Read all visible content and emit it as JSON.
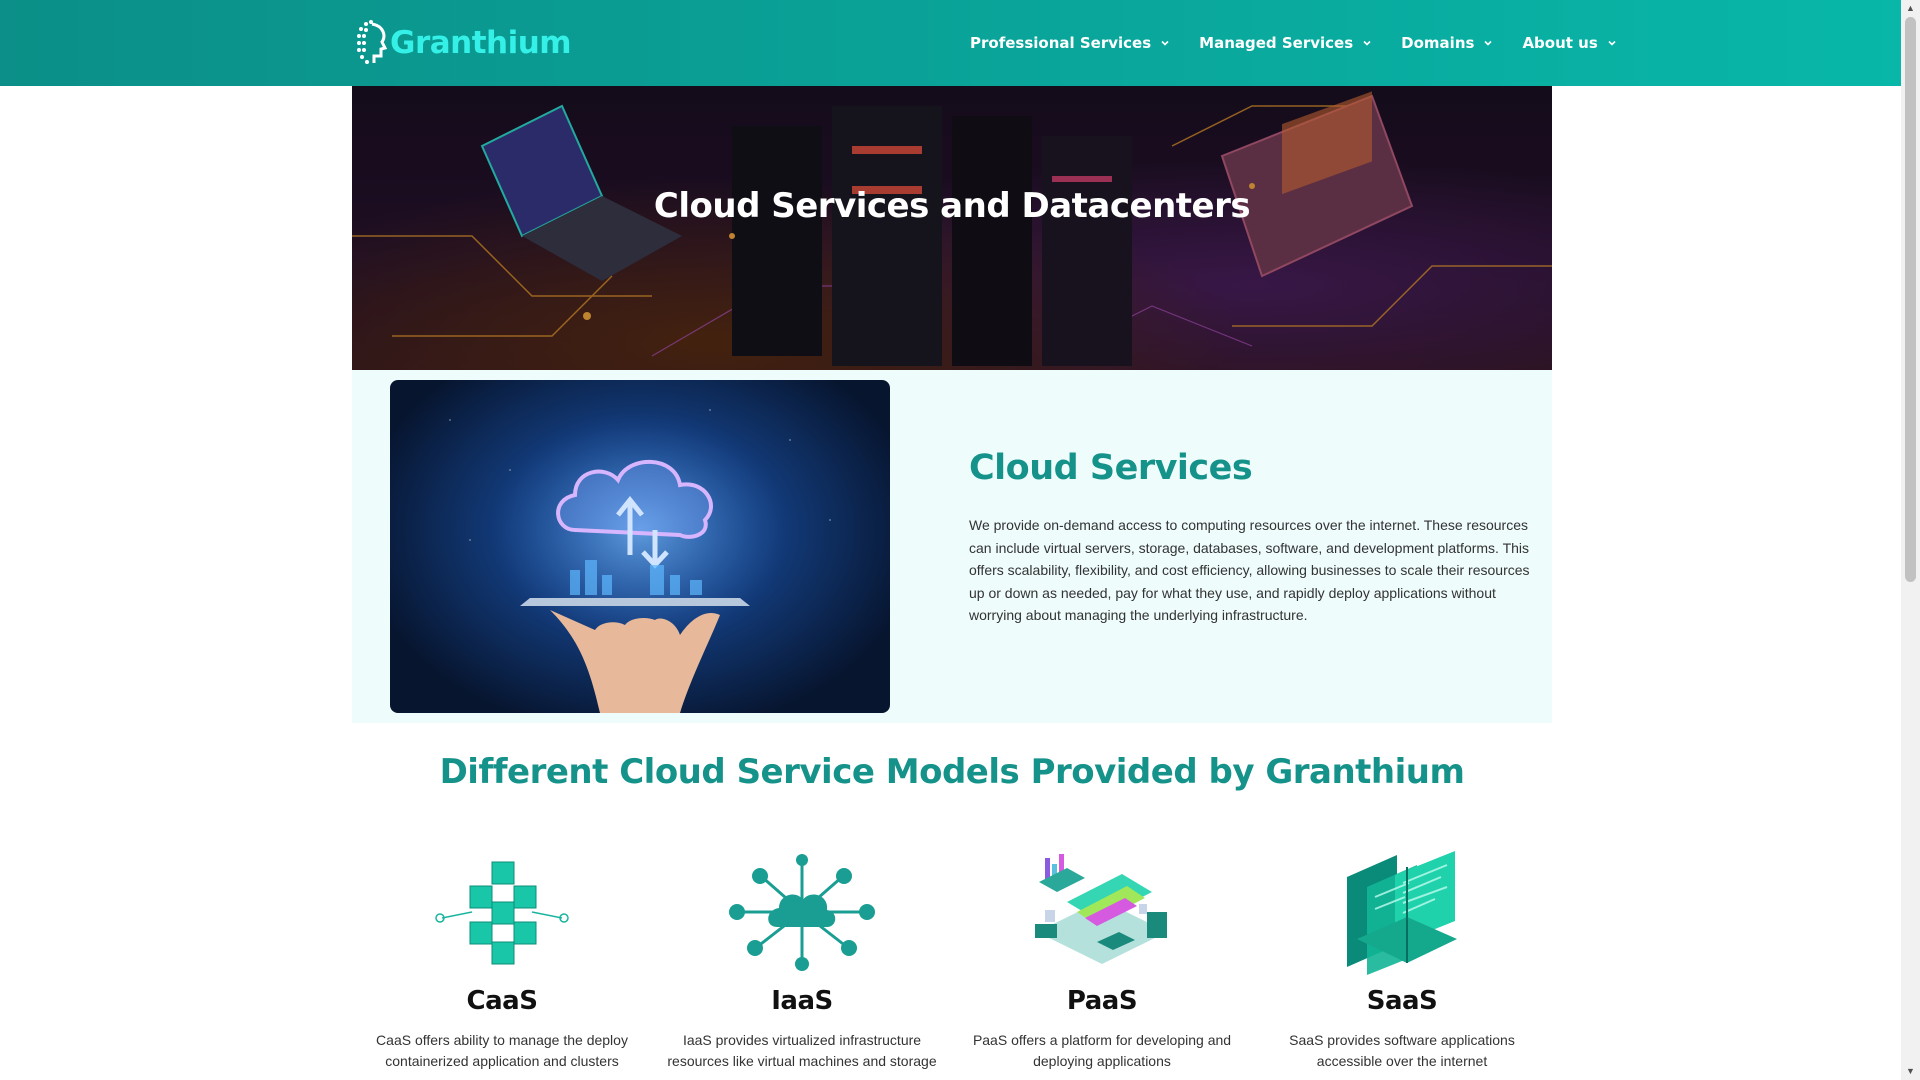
{
  "header": {
    "logo_text": "Granthium",
    "nav": [
      {
        "label": "Professional Services"
      },
      {
        "label": "Managed Services"
      },
      {
        "label": "Domains"
      },
      {
        "label": "About us"
      }
    ],
    "color": "#0aa79c"
  },
  "hero": {
    "title": "Cloud Services and Datacenters"
  },
  "intro": {
    "heading": "Cloud Services",
    "text": "We provide on-demand access to computing resources over the internet. These resources can include virtual servers, storage, databases, software, and development platforms. This offers scalability, flexibility, and cost efficiency, allowing businesses to scale their resources up or down as needed, pay for what they use, and rapidly deploy applications without worrying about managing the underlying infrastructure."
  },
  "models": {
    "heading": "Different Cloud Service Models Provided by Granthium",
    "items": [
      {
        "title": "CaaS",
        "desc": "CaaS offers ability to manage the deploy containerized application and clusters",
        "icon": "cubes-icon"
      },
      {
        "title": "IaaS",
        "desc": "IaaS provides virtualized infrastructure resources like virtual machines and storage",
        "icon": "cloud-network-icon"
      },
      {
        "title": "PaaS",
        "desc": "PaaS offers a platform for developing and deploying applications",
        "icon": "platform-icon"
      },
      {
        "title": "SaaS",
        "desc": "SaaS provides software applications accessible over the internet",
        "icon": "software-screens-icon"
      }
    ]
  },
  "accent_color": "#15928a"
}
